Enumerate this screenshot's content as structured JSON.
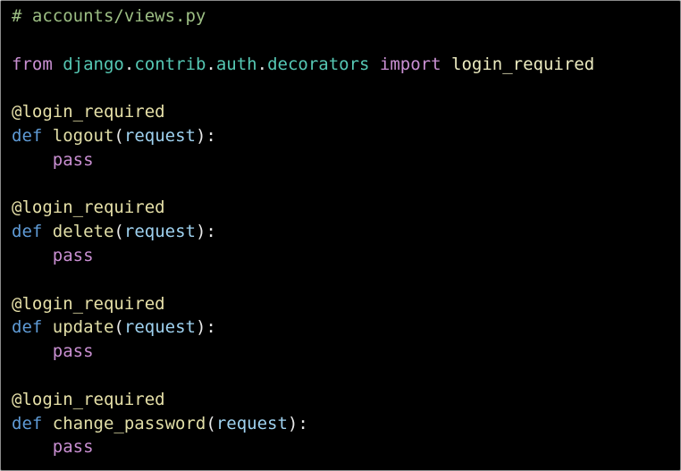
{
  "code": {
    "comment": "# accounts/views.py",
    "import_line": {
      "from": "from",
      "module": "django",
      "dot1": ".",
      "contrib": "contrib",
      "dot2": ".",
      "auth": "auth",
      "dot3": ".",
      "decorators": "decorators",
      "import": "import",
      "name": "login_required"
    },
    "blocks": [
      {
        "decorator": "@login_required",
        "def": "def",
        "name": "logout",
        "open": "(",
        "param": "request",
        "close": "):",
        "body": "pass"
      },
      {
        "decorator": "@login_required",
        "def": "def",
        "name": "delete",
        "open": "(",
        "param": "request",
        "close": "):",
        "body": "pass"
      },
      {
        "decorator": "@login_required",
        "def": "def",
        "name": "update",
        "open": "(",
        "param": "request",
        "close": "):",
        "body": "pass"
      },
      {
        "decorator": "@login_required",
        "def": "def",
        "name": "change_password",
        "open": "(",
        "param": "request",
        "close": "):",
        "body": "pass"
      }
    ]
  },
  "colors": {
    "background": "#000000",
    "comment": "#9dbf84",
    "keyword": "#c98fd2",
    "module": "#56c8b4",
    "decorator": "#e6e0a8",
    "def_keyword": "#5f9bd6",
    "parameter": "#9fd2f0"
  }
}
